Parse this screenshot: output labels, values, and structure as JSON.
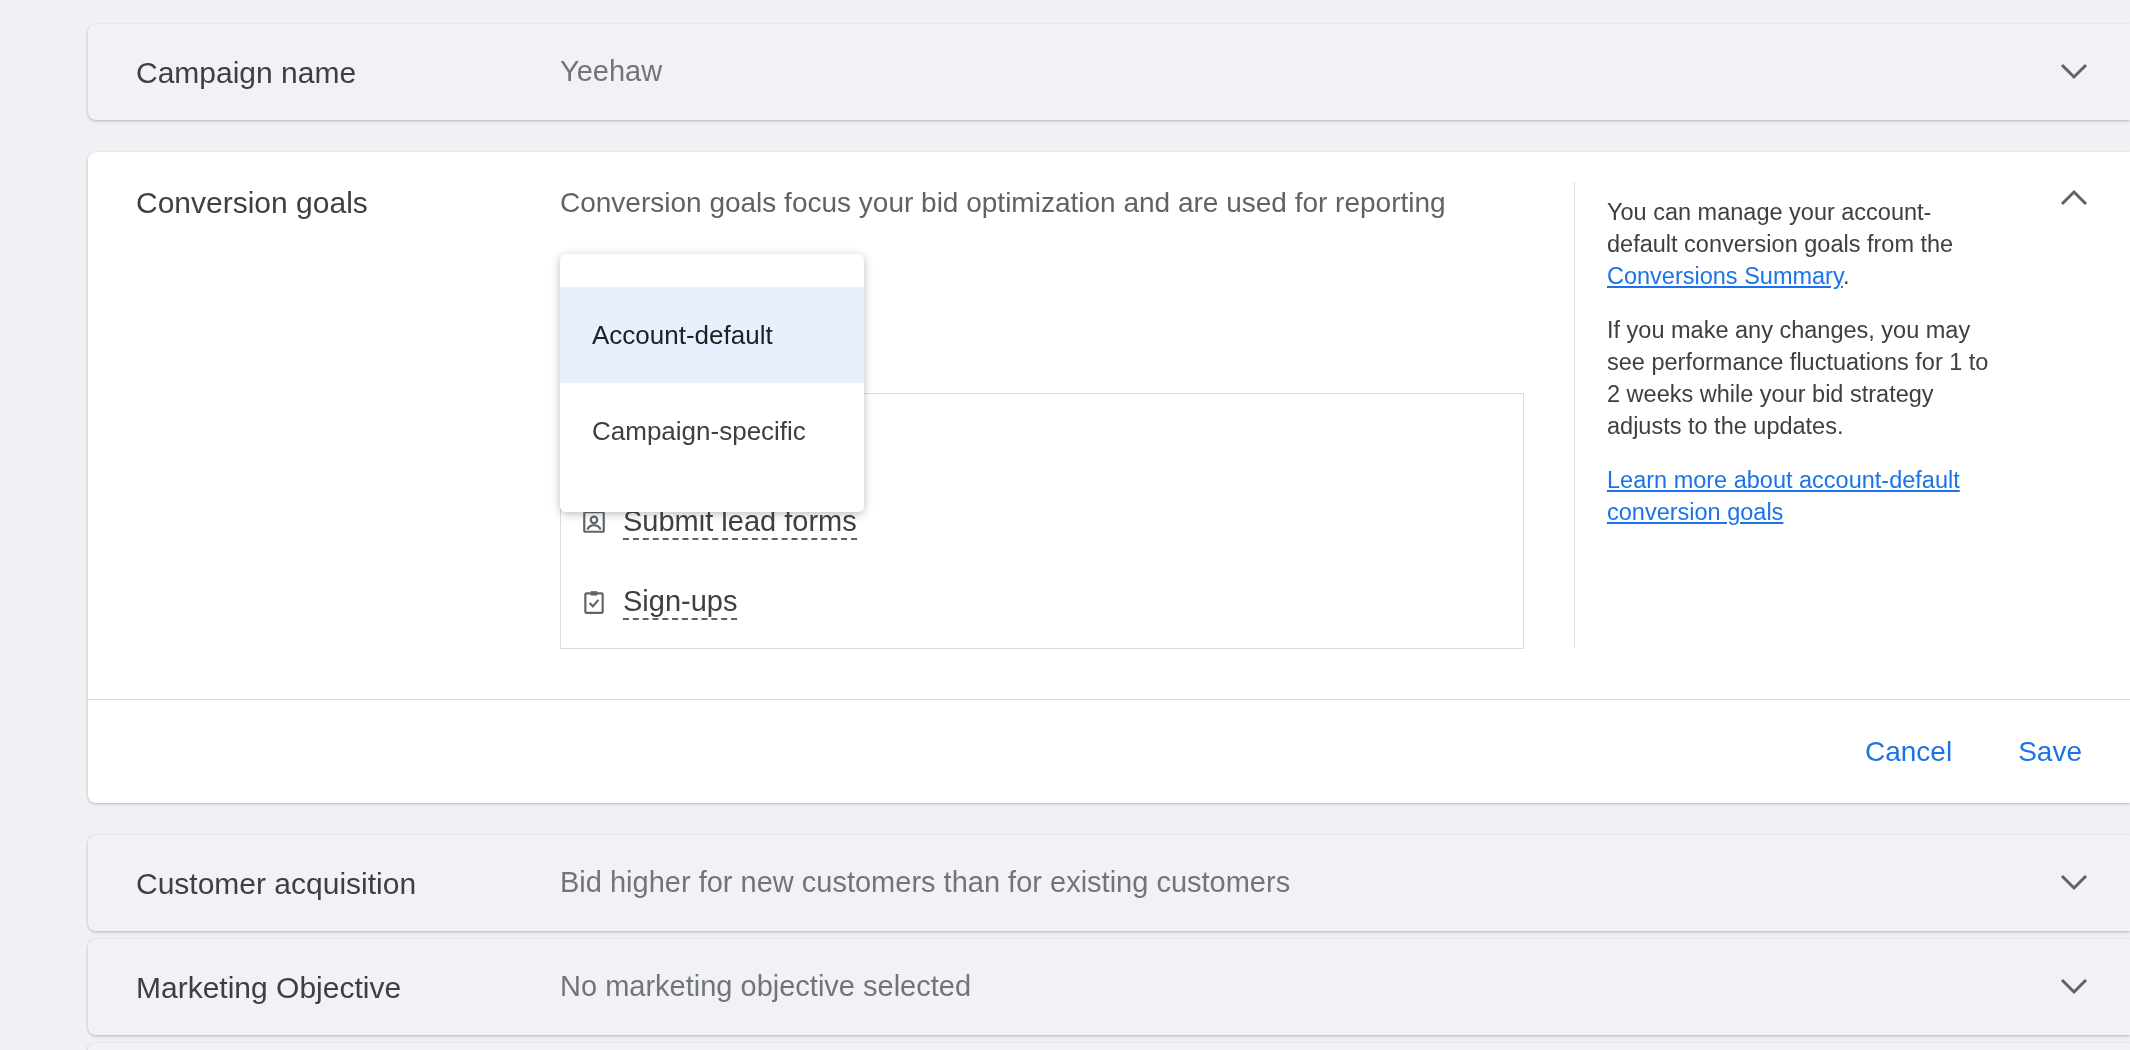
{
  "sections": [
    {
      "label": "Campaign name",
      "summary": "Yeehaw",
      "expanded": false
    },
    {
      "label": "Conversion goals",
      "expanded": true
    },
    {
      "label": "Customer acquisition",
      "summary": "Bid higher for new customers than for existing customers",
      "expanded": false
    },
    {
      "label": "Marketing Objective",
      "summary": "No marketing objective selected",
      "expanded": false
    }
  ],
  "editor": {
    "description": "Conversion goals focus your bid optimization and are used for reporting",
    "menu": [
      {
        "label": "Account-default",
        "selected": true
      },
      {
        "label": "Campaign-specific",
        "selected": false
      }
    ],
    "goals": [
      {
        "label": "Submit lead forms",
        "kind": "lead"
      },
      {
        "label": "Sign-ups",
        "kind": "signup"
      }
    ],
    "help": {
      "before": "You can manage your account-default conversion goals from the ",
      "link": "Conversions Summary",
      "after": ".",
      "note": "If you make any changes, you may see performance fluctuations for 1 to 2 weeks while your bid strategy adjusts to the updates.",
      "learn_more": "Learn more about account-default conversion goals"
    },
    "actions": [
      "Cancel",
      "Save"
    ]
  }
}
